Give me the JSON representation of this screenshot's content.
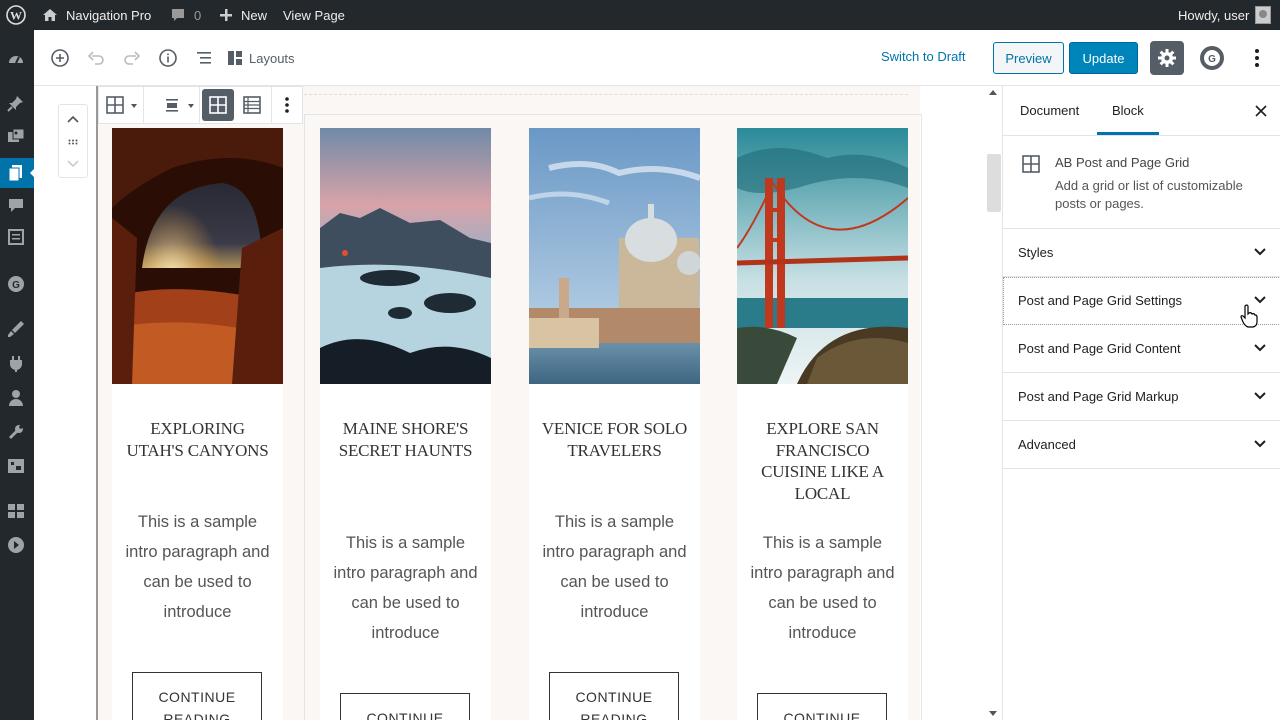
{
  "admin_bar": {
    "site_name": "Navigation Pro",
    "comments_count": "0",
    "new_label": "New",
    "view_page_label": "View Page",
    "greeting": "Howdy, user"
  },
  "editor_header": {
    "layouts_label": "Layouts",
    "switch_to_draft_label": "Switch to Draft",
    "preview_label": "Preview",
    "update_label": "Update",
    "generator_badge": "G"
  },
  "posts": [
    {
      "title": "Exploring Utah's Canyons",
      "excerpt": "This is a sample intro paragraph and can be used to introduce",
      "cta": "CONTINUE READING",
      "image": "canyon-arch-sunset"
    },
    {
      "title": "Maine Shore's Secret Haunts",
      "excerpt": "This is a sample intro paragraph and can be used to introduce",
      "cta": "CONTINUE READING",
      "image": "misty-rocky-shore"
    },
    {
      "title": "Venice For Solo Travelers",
      "excerpt": "This is a sample intro paragraph and can be used to introduce",
      "cta": "CONTINUE READING",
      "image": "venice-grand-canal"
    },
    {
      "title": "Explore San Francisco Cuisine Like A Local",
      "excerpt": "This is a sample intro paragraph and can be used to introduce",
      "cta": "CONTINUE READING",
      "image": "golden-gate-bridge"
    }
  ],
  "sidebar": {
    "tabs": [
      "Document",
      "Block"
    ],
    "active_tab": "Block",
    "block": {
      "name": "AB Post and Page Grid",
      "description": "Add a grid or list of customizable posts or pages."
    },
    "panels": [
      "Styles",
      "Post and Page Grid Settings",
      "Post and Page Grid Content",
      "Post and Page Grid Markup",
      "Advanced"
    ]
  },
  "colors": {
    "admin_bar_bg": "#23282d",
    "accent": "#0073aa",
    "update_button": "#0085ba",
    "block_background": "#fbf7f5"
  }
}
